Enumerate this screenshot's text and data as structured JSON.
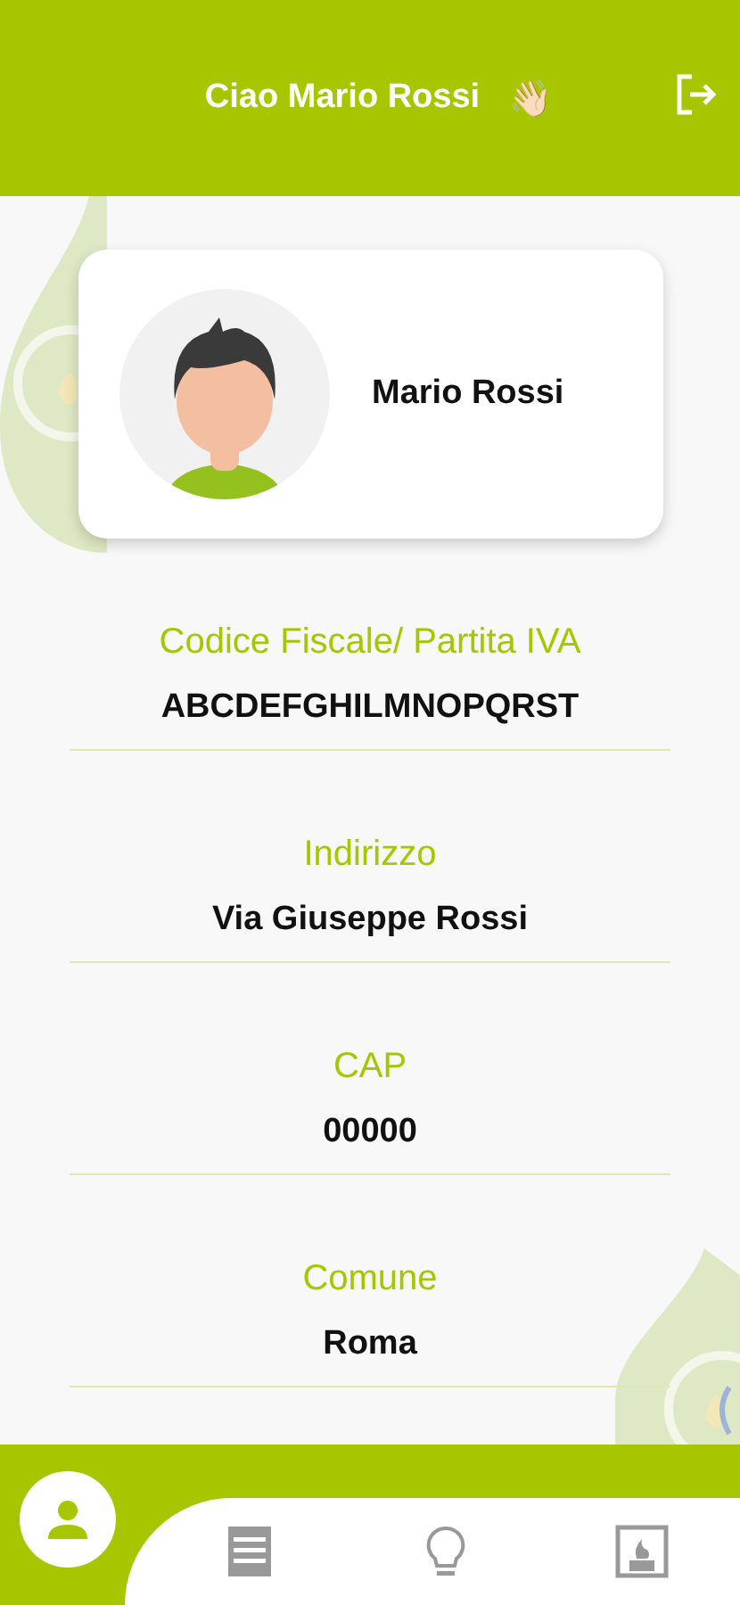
{
  "header": {
    "title": "Ciao Mario Rossi",
    "emoji": "👋🏻"
  },
  "profile": {
    "name": "Mario Rossi"
  },
  "fields": [
    {
      "label": "Codice Fiscale/ Partita IVA",
      "value": "ABCDEFGHILMNOPQRST"
    },
    {
      "label": "Indirizzo",
      "value": "Via Giuseppe Rossi"
    },
    {
      "label": "CAP",
      "value": "00000"
    },
    {
      "label": "Comune",
      "value": "Roma"
    }
  ],
  "nav": [
    {
      "kind": "profile",
      "selected": true
    },
    {
      "kind": "bills",
      "selected": false
    },
    {
      "kind": "tips",
      "selected": false
    },
    {
      "kind": "heating",
      "selected": false
    }
  ]
}
